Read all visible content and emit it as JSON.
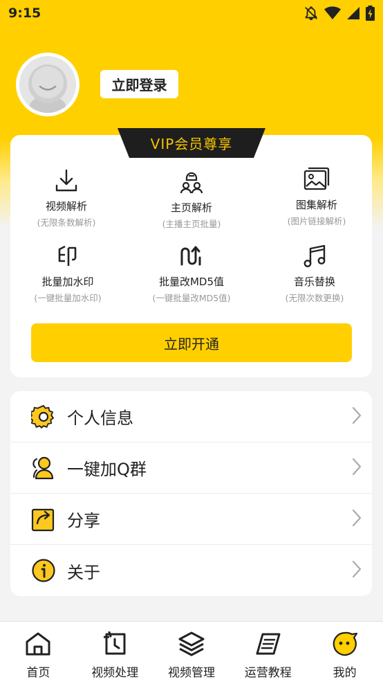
{
  "status_bar": {
    "time": "9:15",
    "icons": [
      "notifications-off-icon",
      "wifi-icon",
      "signal-icon",
      "battery-charging-icon"
    ]
  },
  "profile": {
    "avatar_icon": "default-avatar-icon",
    "login_label": "立即登录"
  },
  "vip": {
    "badge": "VIP会员尊享",
    "features": [
      {
        "icon": "download-icon",
        "title": "视频解析",
        "subtitle": "(无限条数解析)"
      },
      {
        "icon": "people-icon",
        "title": "主页解析",
        "subtitle": "(主播主页批量)"
      },
      {
        "icon": "gallery-icon",
        "title": "图集解析",
        "subtitle": "(图片链接解析)"
      },
      {
        "icon": "stamp-icon",
        "title": "批量加水印",
        "subtitle": "(一键批量加水印)"
      },
      {
        "icon": "wave-icon",
        "title": "批量改MD5值",
        "subtitle": "(一键批量改MD5值)"
      },
      {
        "icon": "music-note-icon",
        "title": "音乐替换",
        "subtitle": "(无限次数更换)"
      }
    ],
    "open_label": "立即开通"
  },
  "menu": [
    {
      "icon": "gear-icon",
      "label": "个人信息"
    },
    {
      "icon": "user-group-icon",
      "label": "一键加Q群"
    },
    {
      "icon": "share-icon",
      "label": "分享"
    },
    {
      "icon": "info-icon",
      "label": "关于"
    }
  ],
  "bottom_nav": [
    {
      "icon": "home-icon",
      "label": "首页"
    },
    {
      "icon": "video-clock-icon",
      "label": "视频处理"
    },
    {
      "icon": "layers-icon",
      "label": "视频管理"
    },
    {
      "icon": "notebook-icon",
      "label": "运营教程"
    },
    {
      "icon": "smiley-icon",
      "label": "我的"
    }
  ],
  "colors": {
    "accent": "#FFCF00",
    "badge_bg": "#1E1E1E",
    "badge_text": "#F5C400"
  }
}
